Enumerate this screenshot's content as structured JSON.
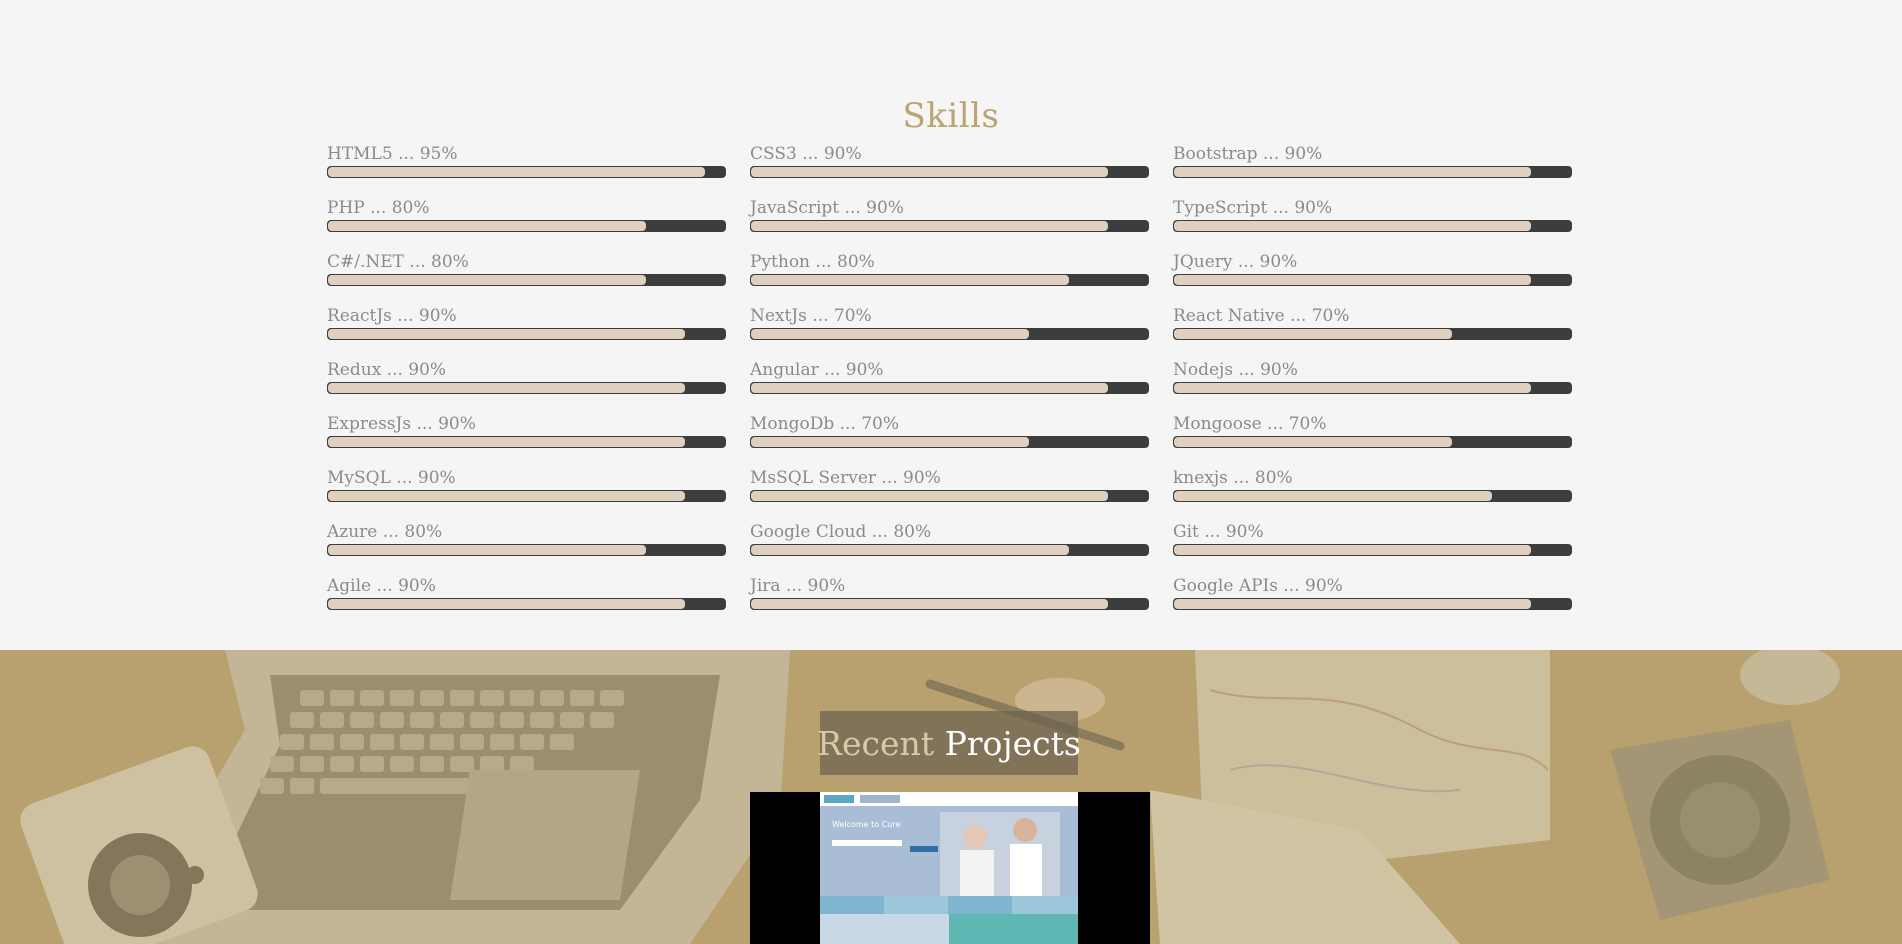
{
  "skills": {
    "title": "Skills",
    "items": [
      {
        "label": "HTML5 ... 95%",
        "level": 0.95
      },
      {
        "label": "CSS3 ... 90%",
        "level": 0.9
      },
      {
        "label": "Bootstrap ... 90%",
        "level": 0.9
      },
      {
        "label": "PHP ... 80%",
        "level": 0.8
      },
      {
        "label": "JavaScript ... 90%",
        "level": 0.9
      },
      {
        "label": "TypeScript ... 90%",
        "level": 0.9
      },
      {
        "label": "C#/.NET ... 80%",
        "level": 0.8
      },
      {
        "label": "Python ... 80%",
        "level": 0.8
      },
      {
        "label": "JQuery ... 90%",
        "level": 0.9
      },
      {
        "label": "ReactJs ... 90%",
        "level": 0.9
      },
      {
        "label": "NextJs ... 70%",
        "level": 0.7
      },
      {
        "label": "React Native ... 70%",
        "level": 0.7
      },
      {
        "label": "Redux ... 90%",
        "level": 0.9
      },
      {
        "label": "Angular ... 90%",
        "level": 0.9
      },
      {
        "label": "Nodejs ... 90%",
        "level": 0.9
      },
      {
        "label": "ExpressJs ... 90%",
        "level": 0.9
      },
      {
        "label": "MongoDb ... 70%",
        "level": 0.7
      },
      {
        "label": "Mongoose ... 70%",
        "level": 0.7
      },
      {
        "label": "MySQL ... 90%",
        "level": 0.9
      },
      {
        "label": "MsSQL Server ... 90%",
        "level": 0.9
      },
      {
        "label": "knexjs ... 80%",
        "level": 0.8
      },
      {
        "label": "Azure ... 80%",
        "level": 0.8
      },
      {
        "label": "Google Cloud ... 80%",
        "level": 0.8
      },
      {
        "label": "Git ... 90%",
        "level": 0.9
      },
      {
        "label": "Agile ... 90%",
        "level": 0.9
      },
      {
        "label": "Jira ... 90%",
        "level": 0.9
      },
      {
        "label": "Google APIs ... 90%",
        "level": 0.9
      }
    ]
  },
  "projects": {
    "title_accent": "Recent",
    "title_main": "Projects",
    "thumb_heading": "Welcome to Cure"
  },
  "colors": {
    "skills_title": "#b8a56f",
    "bar_track": "#3d3d3d",
    "bar_fill": "#e0d0bf",
    "label_text": "#8a8a8a"
  },
  "icons": [
    "laptop-image",
    "camera-image",
    "map-image",
    "cactus-image",
    "pen-image"
  ]
}
